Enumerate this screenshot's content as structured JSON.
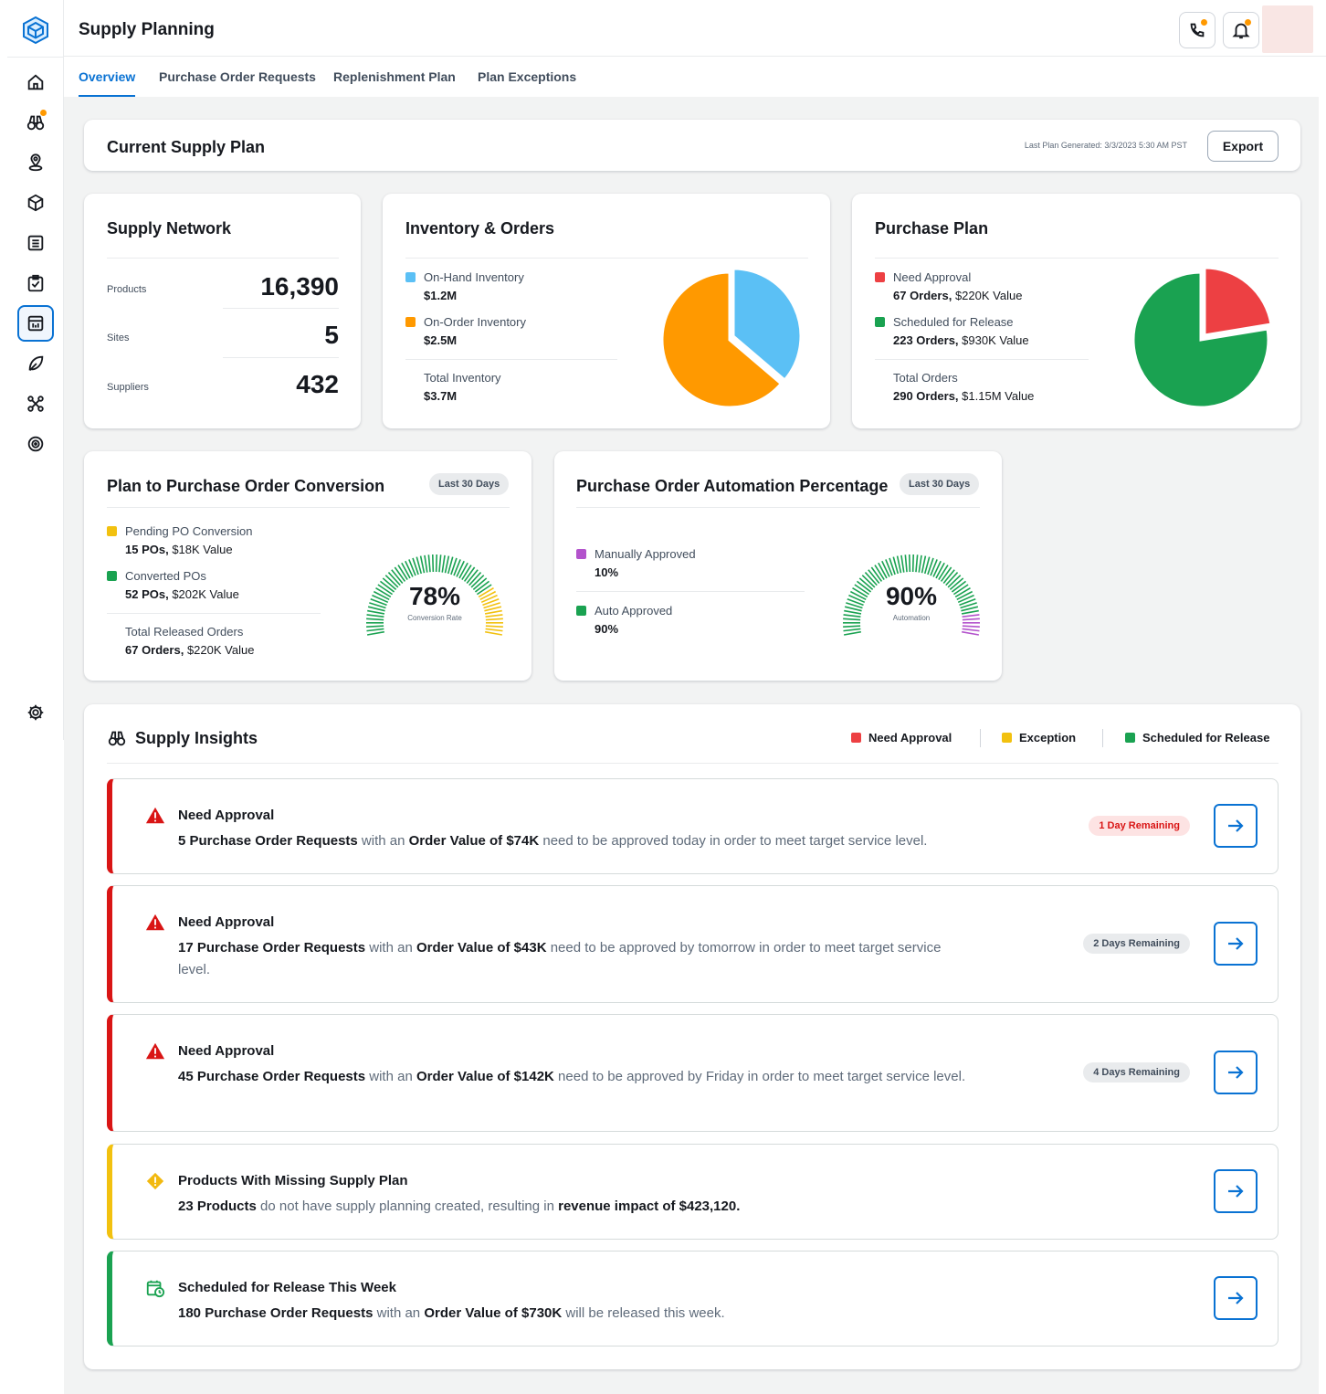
{
  "app": {
    "title": "Supply Planning"
  },
  "tabs": [
    {
      "label": "Overview",
      "active": true
    },
    {
      "label": "Purchase Order Requests"
    },
    {
      "label": "Replenishment Plan"
    },
    {
      "label": "Plan Exceptions"
    }
  ],
  "sidebar": {
    "items": [
      {
        "icon": "home-icon"
      },
      {
        "icon": "binoculars-icon",
        "notification": true
      },
      {
        "icon": "location-pin-icon"
      },
      {
        "icon": "cube-icon"
      },
      {
        "icon": "list-icon"
      },
      {
        "icon": "checklist-icon"
      },
      {
        "icon": "supply-plan-icon",
        "active": true
      },
      {
        "icon": "leaf-icon"
      },
      {
        "icon": "network-icon"
      },
      {
        "icon": "target-icon"
      },
      {
        "icon": "gear-icon"
      }
    ]
  },
  "header_actions": [
    {
      "icon": "contact-support-icon",
      "notification": true
    },
    {
      "icon": "bell-icon",
      "notification": true
    }
  ],
  "current_plan": {
    "title": "Current Supply Plan",
    "last_generated": "Last Plan Generated: 3/3/2023 5:30 AM PST",
    "export_label": "Export"
  },
  "supply_network": {
    "title": "Supply Network",
    "stats": [
      {
        "label": "Products",
        "value": "16,390"
      },
      {
        "label": "Sites",
        "value": "5"
      },
      {
        "label": "Suppliers",
        "value": "432"
      }
    ]
  },
  "inventory_orders": {
    "title": "Inventory & Orders",
    "items": [
      {
        "name": "On-Hand Inventory",
        "value": "$1.2M",
        "color": "#5bc0f5"
      },
      {
        "name": "On-Order Inventory",
        "value": "$2.5M",
        "color": "#ff9900"
      }
    ],
    "total_label": "Total Inventory",
    "total_value": "$3.7M"
  },
  "purchase_plan": {
    "title": "Purchase Plan",
    "items": [
      {
        "name": "Need Approval",
        "value_bold": "67 Orders,",
        "value_rest": " $220K Value",
        "color": "#ed4043"
      },
      {
        "name": "Scheduled for Release",
        "value_bold": "223 Orders,",
        "value_rest": " $930K Value",
        "color": "#1aa251"
      }
    ],
    "total_label": "Total Orders",
    "total_value_bold": "290 Orders,",
    "total_value_rest": " $1.15M Value"
  },
  "conversion": {
    "title": "Plan to Purchase Order Conversion",
    "badge": "Last 30 Days",
    "items": [
      {
        "name": "Pending PO Conversion",
        "value_bold": "15 POs,",
        "value_rest": " $18K Value",
        "color": "#f2c10f"
      },
      {
        "name": "Converted POs",
        "value_bold": "52 POs,",
        "value_rest": " $202K Value",
        "color": "#1aa251"
      }
    ],
    "total_label": "Total Released Orders",
    "total_value_bold": "67 Orders,",
    "total_value_rest": " $220K Value",
    "gauge_value": "78%",
    "gauge_label": "Conversion Rate",
    "gauge_fraction": 0.78
  },
  "automation": {
    "title": "Purchase Order Automation Percentage",
    "badge": "Last 30 Days",
    "items": [
      {
        "name": "Manually Approved",
        "value": "10%",
        "color": "#b353cc"
      },
      {
        "name": "Auto Approved",
        "value": "90%",
        "color": "#1aa251"
      }
    ],
    "gauge_value": "90%",
    "gauge_label": "Automation",
    "gauge_fraction": 0.9
  },
  "insights": {
    "title": "Supply Insights",
    "legend": [
      {
        "label": "Need Approval",
        "color": "#ed4043"
      },
      {
        "label": "Exception",
        "color": "#f2c10f"
      },
      {
        "label": "Scheduled for Release",
        "color": "#1aa251"
      }
    ],
    "items": [
      {
        "type": "approval",
        "title": "Need Approval",
        "d1": "5 Purchase Order Requests",
        "d2": " with an ",
        "d3": "Order Value of $74K",
        "d4": " need to be approved today in order to meet target service level.",
        "badge": "1 Day Remaining"
      },
      {
        "type": "approval",
        "title": "Need Approval",
        "d1": "17 Purchase Order Requests",
        "d2": " with an ",
        "d3": "Order Value of $43K",
        "d4": " need to be approved by tomorrow in order to meet target service level.",
        "badge": "2 Days Remaining"
      },
      {
        "type": "approval",
        "title": "Need Approval",
        "d1": "45 Purchase Order Requests",
        "d2": " with an ",
        "d3": "Order Value of $142K",
        "d4": " need to be approved by Friday in order to meet target service level.",
        "badge": "4 Days Remaining"
      },
      {
        "type": "exception",
        "title": "Products With Missing Supply Plan",
        "d1": "23 Products",
        "d2": " do not have supply planning created, resulting in ",
        "d3": "revenue impact of $423,120.",
        "d4": ""
      },
      {
        "type": "release",
        "title": "Scheduled for Release This Week",
        "d1": "180 Purchase Order Requests",
        "d2": " with an ",
        "d3": "Order Value of $730K",
        "d4": " will be released this week."
      }
    ]
  },
  "colors": {
    "accent": "#0972d3",
    "need_approval": "#ed4043",
    "exception": "#f2c10f",
    "scheduled": "#1aa251",
    "on_hand": "#5bc0f5",
    "on_order": "#ff9900",
    "manual": "#b353cc"
  }
}
